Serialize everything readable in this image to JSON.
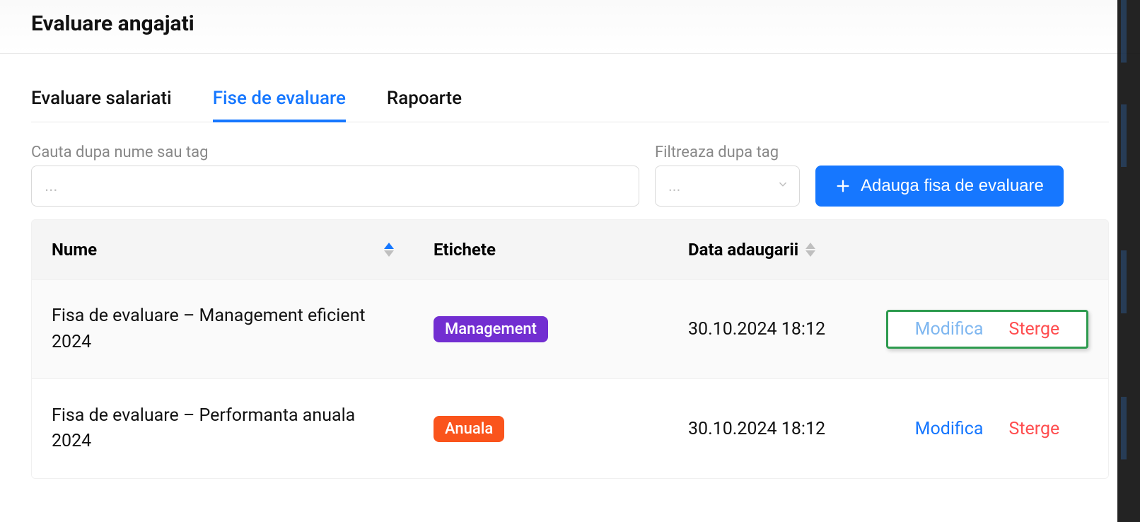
{
  "page": {
    "title": "Evaluare angajati"
  },
  "tabs": [
    {
      "label": "Evaluare salariati",
      "active": false
    },
    {
      "label": "Fise de evaluare",
      "active": true
    },
    {
      "label": "Rapoarte",
      "active": false
    }
  ],
  "search": {
    "label": "Cauta dupa nume sau tag",
    "placeholder": "...",
    "value": ""
  },
  "filter": {
    "label": "Filtreaza dupa tag",
    "placeholder": "...",
    "value": ""
  },
  "add_button": {
    "label": "Adauga fisa de evaluare"
  },
  "table": {
    "columns": {
      "name": "Nume",
      "tags": "Etichete",
      "date": "Data adaugarii",
      "actions": ""
    },
    "actions": {
      "edit": "Modifica",
      "delete": "Sterge"
    },
    "rows": [
      {
        "name": "Fisa de evaluare – Management eficient 2024",
        "tags": [
          {
            "text": "Management",
            "kind": "management"
          }
        ],
        "date": "30.10.2024 18:12",
        "highlight_actions": true
      },
      {
        "name": "Fisa de evaluare – Performanta anuala 2024",
        "tags": [
          {
            "text": "Anuala",
            "kind": "anuala"
          }
        ],
        "date": "30.10.2024 18:12",
        "highlight_actions": false
      }
    ]
  },
  "colors": {
    "primary": "#1677ff",
    "tag_management": "#722ed1",
    "tag_anuala": "#fa541c",
    "danger": "#ff4d4f",
    "highlight_border": "#2e9b4f"
  }
}
